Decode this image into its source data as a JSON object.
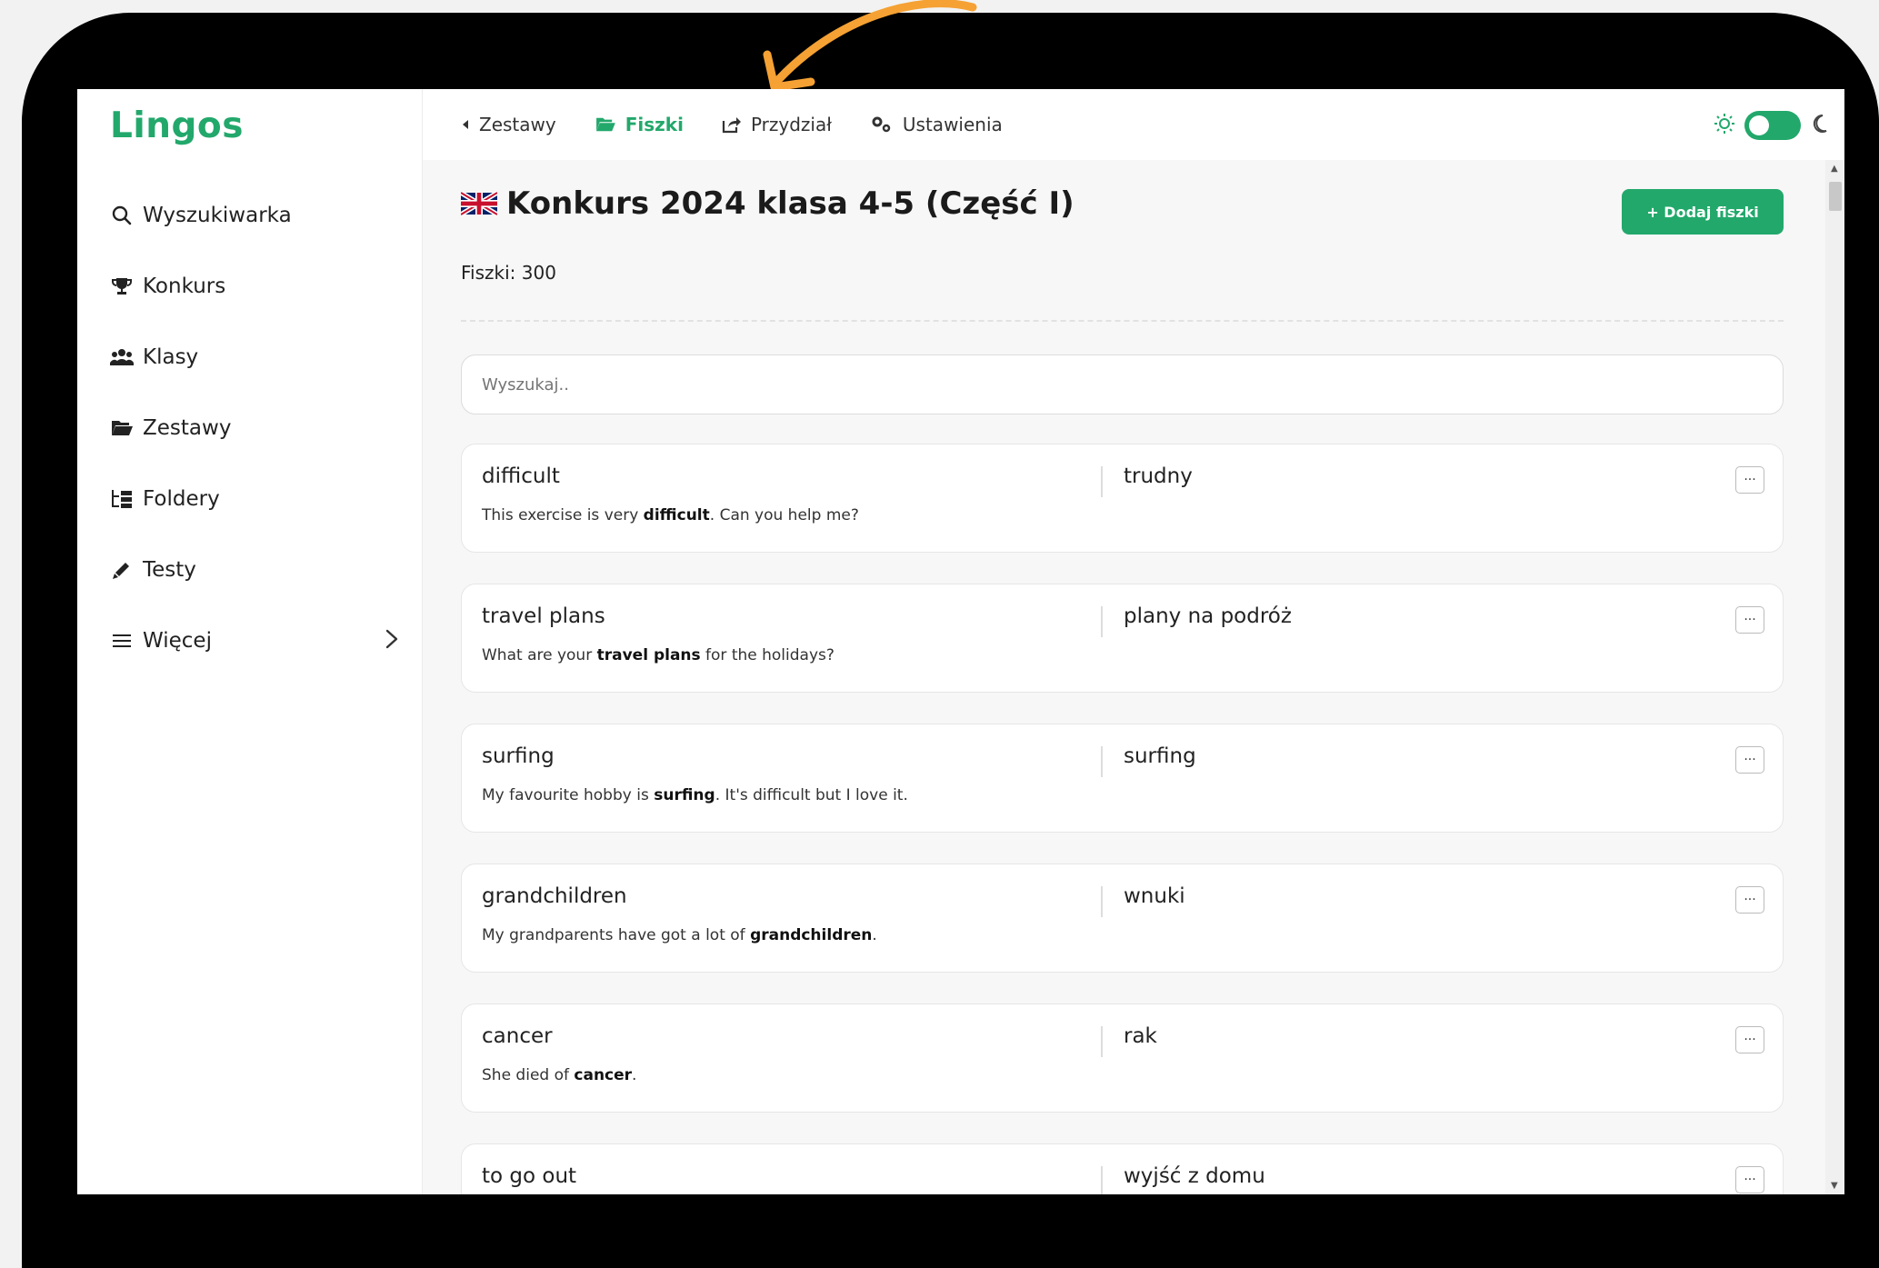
{
  "app": {
    "logo": "Lingos"
  },
  "sidebar": {
    "items": [
      {
        "label": "Wyszukiwarka",
        "icon": "search-icon"
      },
      {
        "label": "Konkurs",
        "icon": "trophy-icon"
      },
      {
        "label": "Klasy",
        "icon": "users-icon"
      },
      {
        "label": "Zestawy",
        "icon": "folder-icon"
      },
      {
        "label": "Foldery",
        "icon": "folder-tree-icon"
      },
      {
        "label": "Testy",
        "icon": "pencil-icon"
      },
      {
        "label": "Więcej",
        "icon": "menu-icon"
      }
    ]
  },
  "topbar": {
    "back": "Zestawy",
    "flashcards": "Fiszki",
    "assign": "Przydział",
    "settings": "Ustawienia"
  },
  "page": {
    "title": "Konkurs 2024 klasa 4-5 (Część I)",
    "count": "Fiszki: 300",
    "add_button": "+ Dodaj fiszki",
    "search_placeholder": "Wyszukaj.."
  },
  "cards": [
    {
      "term": "difficult",
      "translation": "trudny",
      "pre": "This exercise is very ",
      "bold": "difficult",
      "post": ". Can you help me?"
    },
    {
      "term": "travel plans",
      "translation": "plany na podróż",
      "pre": "What are your ",
      "bold": "travel plans",
      "post": " for the holidays?"
    },
    {
      "term": "surfing",
      "translation": "surfing",
      "pre": "My favourite hobby is ",
      "bold": "surfing",
      "post": ". It's difficult but I love it."
    },
    {
      "term": "grandchildren",
      "translation": "wnuki",
      "pre": "My grandparents have got a lot of ",
      "bold": "grandchildren",
      "post": "."
    },
    {
      "term": "cancer",
      "translation": "rak",
      "pre": "She died of ",
      "bold": "cancer",
      "post": "."
    },
    {
      "term": "to go out",
      "translation": "wyjść z domu",
      "pre": "",
      "bold": "",
      "post": ""
    }
  ],
  "more_label": "···",
  "colors": {
    "accent": "#22a86b",
    "arrow": "#f5a134"
  }
}
